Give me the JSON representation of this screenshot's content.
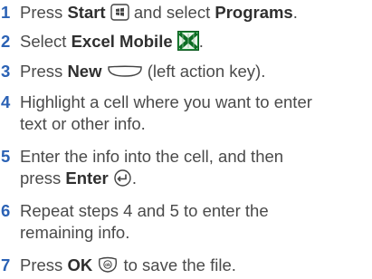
{
  "steps": [
    {
      "number": "1",
      "pre": "Press ",
      "bold1": "Start",
      "mid": " and select ",
      "bold2": "Programs",
      "post": ".",
      "icon": "windows-start-key-icon"
    },
    {
      "number": "2",
      "pre": "Select ",
      "bold1": "Excel Mobile",
      "post": ".",
      "icon": "excel-mobile-icon"
    },
    {
      "number": "3",
      "pre": "Press ",
      "bold1": "New",
      "post": " (left action key).",
      "icon": "left-action-key-icon"
    },
    {
      "number": "4",
      "line1": "Highlight a cell where you want to enter",
      "line2": "text or other info."
    },
    {
      "number": "5",
      "line1": "Enter the info into the cell, and then",
      "pre": "press ",
      "bold1": "Enter",
      "post": ".",
      "icon": "enter-key-icon"
    },
    {
      "number": "6",
      "line1": "Repeat steps 4 and 5 to enter the",
      "line2": "remaining info."
    },
    {
      "number": "7",
      "pre": "Press ",
      "bold1": "OK",
      "post": " to save the file.",
      "icon": "ok-key-icon"
    }
  ]
}
